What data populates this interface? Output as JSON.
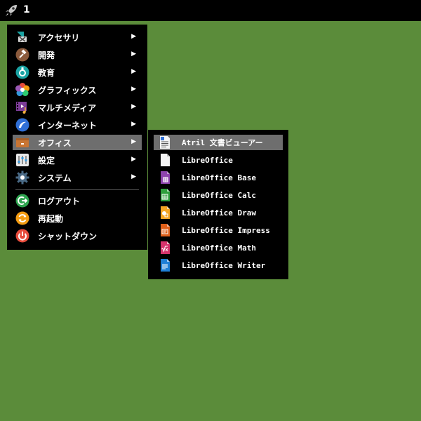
{
  "topbar": {
    "workspace": "1"
  },
  "menu": {
    "items": [
      {
        "label": "アクセサリ",
        "icon": "accessories-icon",
        "arrow": "▶"
      },
      {
        "label": "開発",
        "icon": "development-icon",
        "arrow": "▶"
      },
      {
        "label": "教育",
        "icon": "education-icon",
        "arrow": "▶"
      },
      {
        "label": "グラフィックス",
        "icon": "graphics-icon",
        "arrow": "▶"
      },
      {
        "label": "マルチメディア",
        "icon": "multimedia-icon",
        "arrow": "▶"
      },
      {
        "label": "インターネット",
        "icon": "internet-icon",
        "arrow": "▶"
      },
      {
        "label": "オフィス",
        "icon": "office-icon",
        "arrow": "▶"
      },
      {
        "label": "設定",
        "icon": "settings-icon",
        "arrow": "▶"
      },
      {
        "label": "システム",
        "icon": "system-icon",
        "arrow": "▶"
      }
    ],
    "session": [
      {
        "label": "ログアウト",
        "icon": "logout-icon"
      },
      {
        "label": "再起動",
        "icon": "restart-icon"
      },
      {
        "label": "シャットダウン",
        "icon": "shutdown-icon"
      }
    ]
  },
  "submenu": {
    "items": [
      {
        "label": "Atril 文書ビューアー",
        "icon": "atril-icon"
      },
      {
        "label": "LibreOffice",
        "icon": "libreoffice-icon"
      },
      {
        "label": "LibreOffice Base",
        "icon": "libreoffice-base-icon"
      },
      {
        "label": "LibreOffice Calc",
        "icon": "libreoffice-calc-icon"
      },
      {
        "label": "LibreOffice Draw",
        "icon": "libreoffice-draw-icon"
      },
      {
        "label": "LibreOffice Impress",
        "icon": "libreoffice-impress-icon"
      },
      {
        "label": "LibreOffice Math",
        "icon": "libreoffice-math-icon"
      },
      {
        "label": "LibreOffice Writer",
        "icon": "libreoffice-writer-icon"
      }
    ]
  },
  "colors": {
    "desktop": "#5b8c3a",
    "menu_bg": "#000000",
    "highlight": "#6e6e6e",
    "base": "#8e44ad",
    "calc": "#2e9e3c",
    "draw": "#f5a623",
    "impress": "#e0601a",
    "math": "#d6336c",
    "writer": "#1e7fd6"
  }
}
